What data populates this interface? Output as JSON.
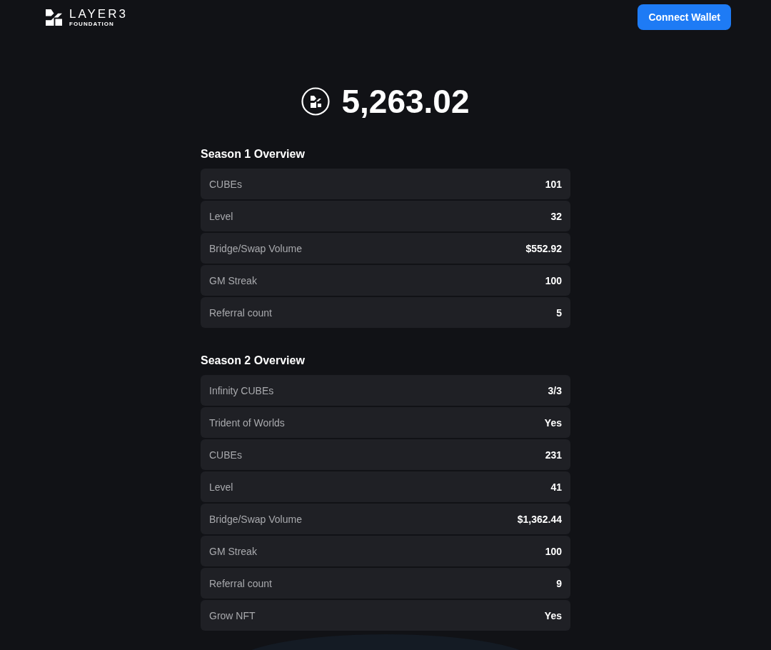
{
  "header": {
    "logo_text": "LAYER3",
    "logo_subtext": "FOUNDATION",
    "button": "Connect Wallet"
  },
  "balance": "5,263.02",
  "sections": [
    {
      "title": "Season 1 Overview",
      "rows": [
        {
          "label": "CUBEs",
          "value": "101"
        },
        {
          "label": "Level",
          "value": "32"
        },
        {
          "label": "Bridge/Swap Volume",
          "value": "$552.92"
        },
        {
          "label": "GM Streak",
          "value": "100"
        },
        {
          "label": "Referral count",
          "value": "5"
        }
      ]
    },
    {
      "title": "Season 2 Overview",
      "rows": [
        {
          "label": "Infinity CUBEs",
          "value": "3/3"
        },
        {
          "label": "Trident of Worlds",
          "value": "Yes"
        },
        {
          "label": "CUBEs",
          "value": "231"
        },
        {
          "label": "Level",
          "value": "41"
        },
        {
          "label": "Bridge/Swap Volume",
          "value": "$1,362.44"
        },
        {
          "label": "GM Streak",
          "value": "100"
        },
        {
          "label": "Referral count",
          "value": "9"
        },
        {
          "label": "Grow NFT",
          "value": "Yes"
        }
      ]
    }
  ]
}
